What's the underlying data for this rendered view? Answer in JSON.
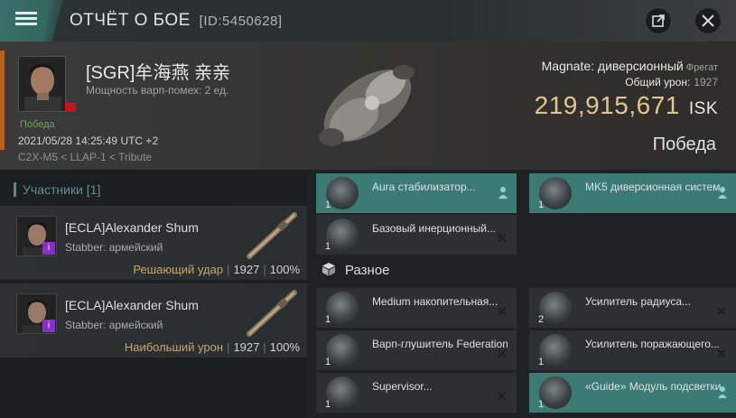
{
  "header": {
    "title": "ОТЧЁТ О БОЕ",
    "report_id": "[ID:5450628]"
  },
  "victim": {
    "name": "[SGR]牟海燕 亲亲",
    "warp_disruption": "Мощность варп-помех: 2 ед.",
    "status": "Победа",
    "datetime": "2021/05/28 14:25:49 UTC +2",
    "location": "C2X-M5 < LLAP-1 < Tribute",
    "ship_type": "Magnate: диверсионный",
    "ship_class": "Фрегат",
    "total_damage_label": "Общий урон:",
    "total_damage": "1927",
    "isk_value": "219,915,671",
    "isk_unit": "ISK",
    "result": "Победа"
  },
  "participants": {
    "label": "Участники",
    "count": "[1]",
    "items": [
      {
        "name": "[ECLA]Alexander Shum",
        "ship": "Stabber: армейский",
        "tag": "Решающий удар",
        "damage": "1927",
        "percent": "100%"
      },
      {
        "name": "[ECLA]Alexander Shum",
        "ship": "Stabber: армейский",
        "tag": "Наибольший урон",
        "damage": "1927",
        "percent": "100%"
      }
    ]
  },
  "modules": {
    "top": [
      {
        "name": "Aura стабилизатор...",
        "qty": "1"
      },
      {
        "name": "MK5 диверсионная систем...",
        "qty": "1"
      },
      {
        "name": "Базовый инерционный...",
        "qty": "1"
      }
    ],
    "section_label": "Разное",
    "misc": [
      {
        "name": "Medium накопительная...",
        "qty": "1"
      },
      {
        "name": "Усилитель радиуса...",
        "qty": "2"
      },
      {
        "name": "Варп-глушитель Federation ...",
        "qty": "1"
      },
      {
        "name": "Усилитель поражающего...",
        "qty": "1"
      },
      {
        "name": "Supervisor...",
        "qty": "1"
      },
      {
        "name": "«Guide» Модуль подсветки...",
        "qty": "1"
      }
    ]
  },
  "colors": {
    "accent_teal": "#3c7a74",
    "isk_gold": "#e4c48a",
    "victory_green": "#6da85c",
    "tag_gold": "#c9a56a"
  }
}
